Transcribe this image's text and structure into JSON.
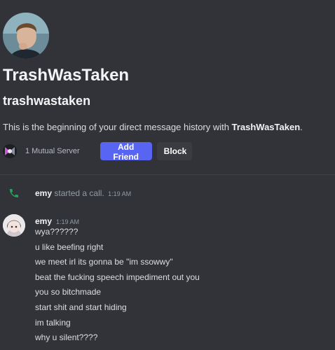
{
  "profile": {
    "display_name": "TrashWasTaken",
    "username": "trashwastaken",
    "intro_prefix": "This is the beginning of your direct message history with ",
    "intro_name": "TrashWasTaken",
    "intro_suffix": "."
  },
  "mutual": {
    "text": "1 Mutual Server",
    "add_friend_label": "Add Friend",
    "block_label": "Block"
  },
  "call": {
    "author": "emy",
    "text": " started a call.",
    "time": "1:19 AM",
    "icon": "phone-icon",
    "icon_color": "#23a55a"
  },
  "message": {
    "author": "emy",
    "time": "1:19 AM",
    "lines": [
      "wya??????",
      "u like beefing right",
      "we meet irl its gonna be \"im ssowwy\"",
      "beat the fucking speech impediment out you",
      "you so bitchmade",
      "start shit and start hiding",
      "im talking",
      "why u silent????"
    ]
  },
  "colors": {
    "background": "#313338",
    "accent": "#5865f2"
  }
}
